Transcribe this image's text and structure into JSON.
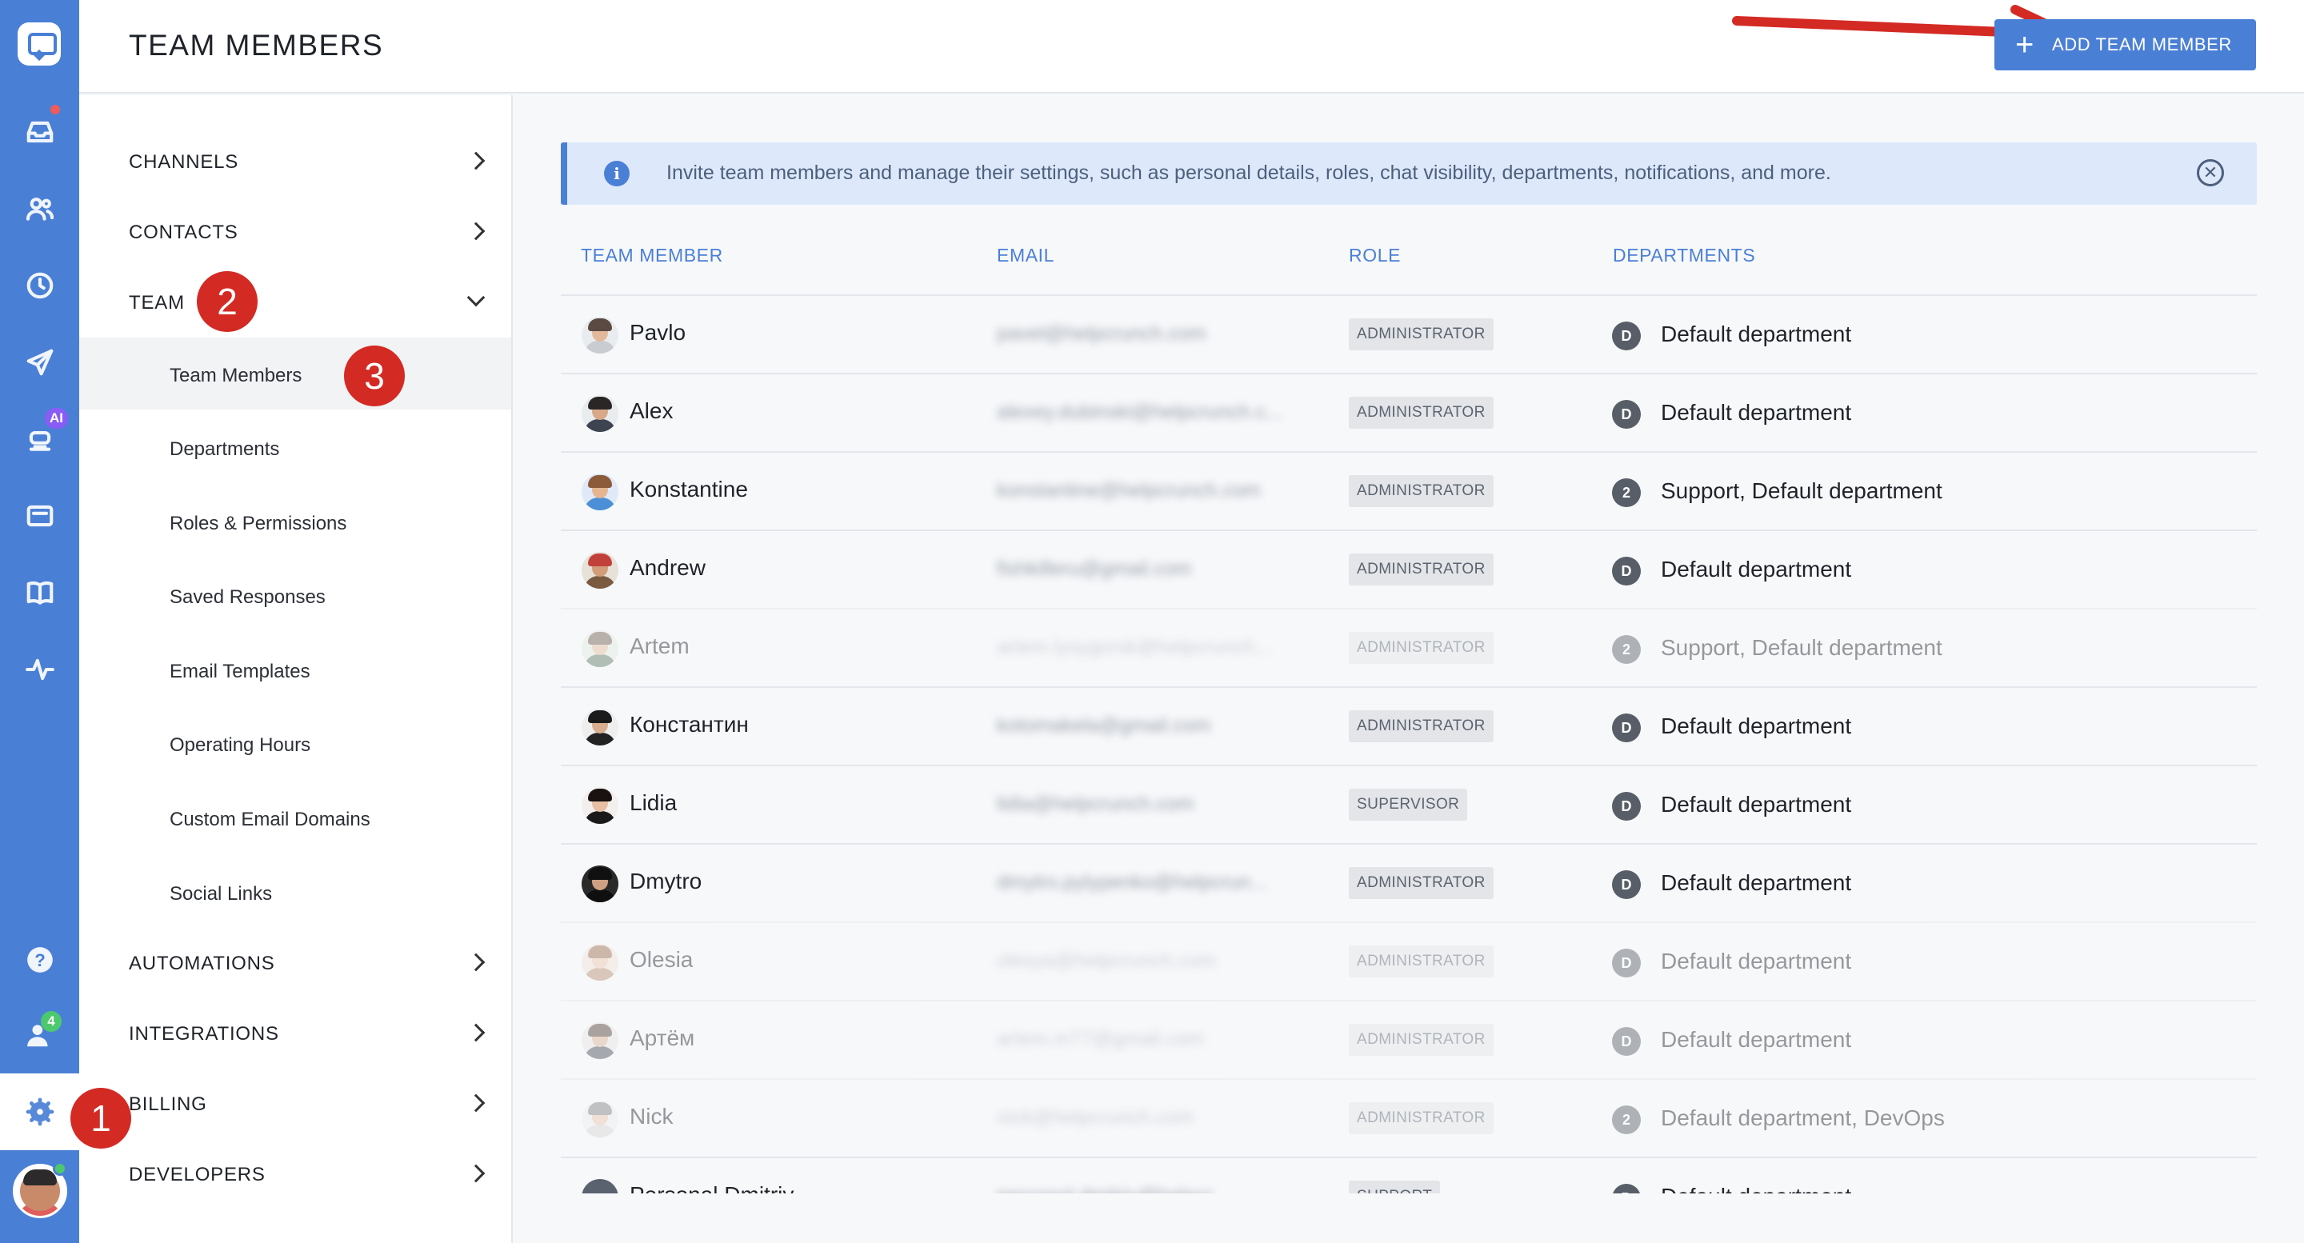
{
  "header": {
    "title": "TEAM MEMBERS",
    "add_button_label": "ADD TEAM MEMBER"
  },
  "nav": {
    "sections": [
      {
        "label": "CHANNELS",
        "state": "collapsed"
      },
      {
        "label": "CONTACTS",
        "state": "collapsed"
      },
      {
        "label": "TEAM",
        "state": "expanded"
      },
      {
        "label": "AUTOMATIONS",
        "state": "collapsed"
      },
      {
        "label": "INTEGRATIONS",
        "state": "collapsed"
      },
      {
        "label": "BILLING",
        "state": "collapsed"
      },
      {
        "label": "DEVELOPERS",
        "state": "collapsed"
      }
    ],
    "team_items": [
      {
        "label": "Team Members",
        "active": true
      },
      {
        "label": "Departments"
      },
      {
        "label": "Roles & Permissions"
      },
      {
        "label": "Saved Responses"
      },
      {
        "label": "Email Templates"
      },
      {
        "label": "Operating Hours"
      },
      {
        "label": "Custom Email Domains"
      },
      {
        "label": "Social Links"
      }
    ]
  },
  "rail": {
    "icons": [
      "logo-icon",
      "inbox-icon",
      "contacts-icon",
      "history-icon",
      "send-icon",
      "ai-bot-icon",
      "widget-icon",
      "knowledge-base-icon",
      "activity-icon",
      "help-icon",
      "team-online-icon",
      "settings-icon"
    ],
    "ai_badge": "AI",
    "online_count": "4",
    "colors": {
      "rail": "#4a7fd6",
      "notification": "#ef5a5a",
      "ai_badge": "#8a5cf6",
      "online": "#4cc96d"
    }
  },
  "callouts": [
    "1",
    "2",
    "3"
  ],
  "banner": {
    "text": "Invite team members and manage their settings, such as personal details, roles, chat visibility, departments, notifications, and more."
  },
  "table": {
    "columns": [
      "TEAM MEMBER",
      "EMAIL",
      "ROLE",
      "DEPARTMENTS"
    ],
    "rows": [
      {
        "name": "Pavlo",
        "email": "pavel@helpcrunch.com",
        "role": "ADMINISTRATOR",
        "dept_badge": "D",
        "departments": "Default department",
        "dim": false
      },
      {
        "name": "Alex",
        "email": "alexey.dubinski@helpcrunch.c...",
        "role": "ADMINISTRATOR",
        "dept_badge": "D",
        "departments": "Default department",
        "dim": false
      },
      {
        "name": "Konstantine",
        "email": "konstantine@helpcrunch.com",
        "role": "ADMINISTRATOR",
        "dept_badge": "2",
        "departments": "Support, Default department",
        "dim": false
      },
      {
        "name": "Andrew",
        "email": "fishkilleru@gmail.com",
        "role": "ADMINISTRATOR",
        "dept_badge": "D",
        "departments": "Default department",
        "dim": false
      },
      {
        "name": "Artem",
        "email": "artem.lysygorsk@helpcrunch...",
        "role": "ADMINISTRATOR",
        "dept_badge": "2",
        "departments": "Support, Default department",
        "dim": true
      },
      {
        "name": "Константин",
        "email": "kotomakela@gmail.com",
        "role": "ADMINISTRATOR",
        "dept_badge": "D",
        "departments": "Default department",
        "dim": false
      },
      {
        "name": "Lidia",
        "email": "lidia@helpcrunch.com",
        "role": "SUPERVISOR",
        "dept_badge": "D",
        "departments": "Default department",
        "dim": false
      },
      {
        "name": "Dmytro",
        "email": "dmytro.pylypenko@helpcrun...",
        "role": "ADMINISTRATOR",
        "dept_badge": "D",
        "departments": "Default department",
        "dim": false
      },
      {
        "name": "Olesia",
        "email": "olesya@helpcrunch.com",
        "role": "ADMINISTRATOR",
        "dept_badge": "D",
        "departments": "Default department",
        "dim": true
      },
      {
        "name": "Артём",
        "email": "artem.m77@gmail.com",
        "role": "ADMINISTRATOR",
        "dept_badge": "D",
        "departments": "Default department",
        "dim": true
      },
      {
        "name": "Nick",
        "email": "nick@helpcrunch.com",
        "role": "ADMINISTRATOR",
        "dept_badge": "2",
        "departments": "Default department, DevOps",
        "dim": true
      },
      {
        "name": "Personal Dmitriy",
        "email": "personal.dmitriy@helpcr...",
        "role": "SUPPORT",
        "dept_badge": "D",
        "departments": "Default department",
        "dim": false
      }
    ]
  }
}
